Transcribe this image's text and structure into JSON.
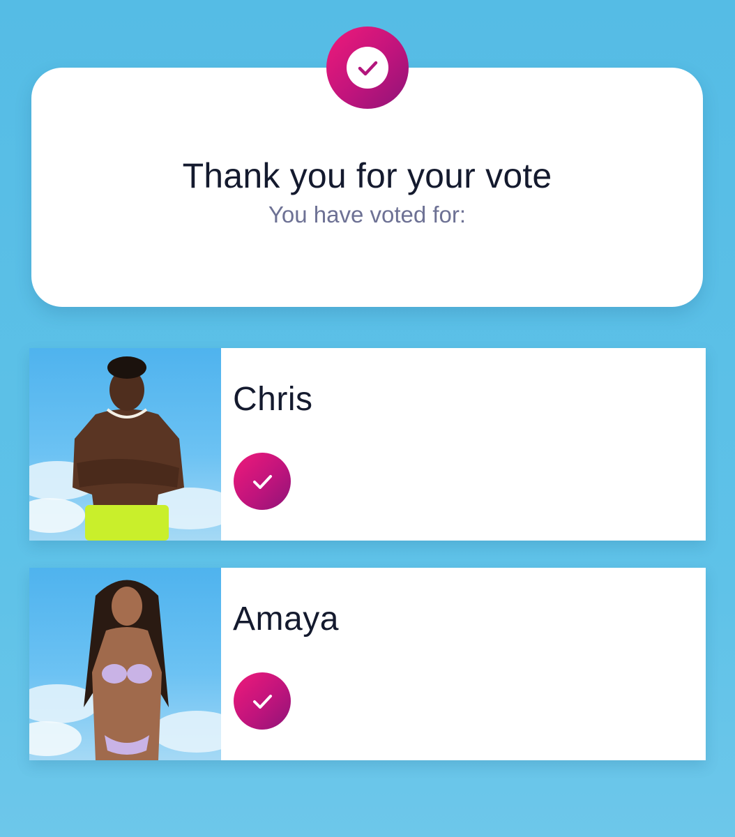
{
  "confirmation": {
    "title": "Thank you for your vote",
    "subtitle": "You have voted for:",
    "badge_icon": "checkmark-icon"
  },
  "votes": [
    {
      "name": "Chris",
      "status_icon": "checkmark-icon",
      "photo": "islander-photo"
    },
    {
      "name": "Amaya",
      "status_icon": "checkmark-icon",
      "photo": "islander-photo"
    }
  ],
  "colors": {
    "background": "#57bde6",
    "accent_pink": "#e3187b",
    "accent_purple": "#8f1478",
    "title_text": "#141a2e",
    "subtitle_text": "#6d7194"
  }
}
